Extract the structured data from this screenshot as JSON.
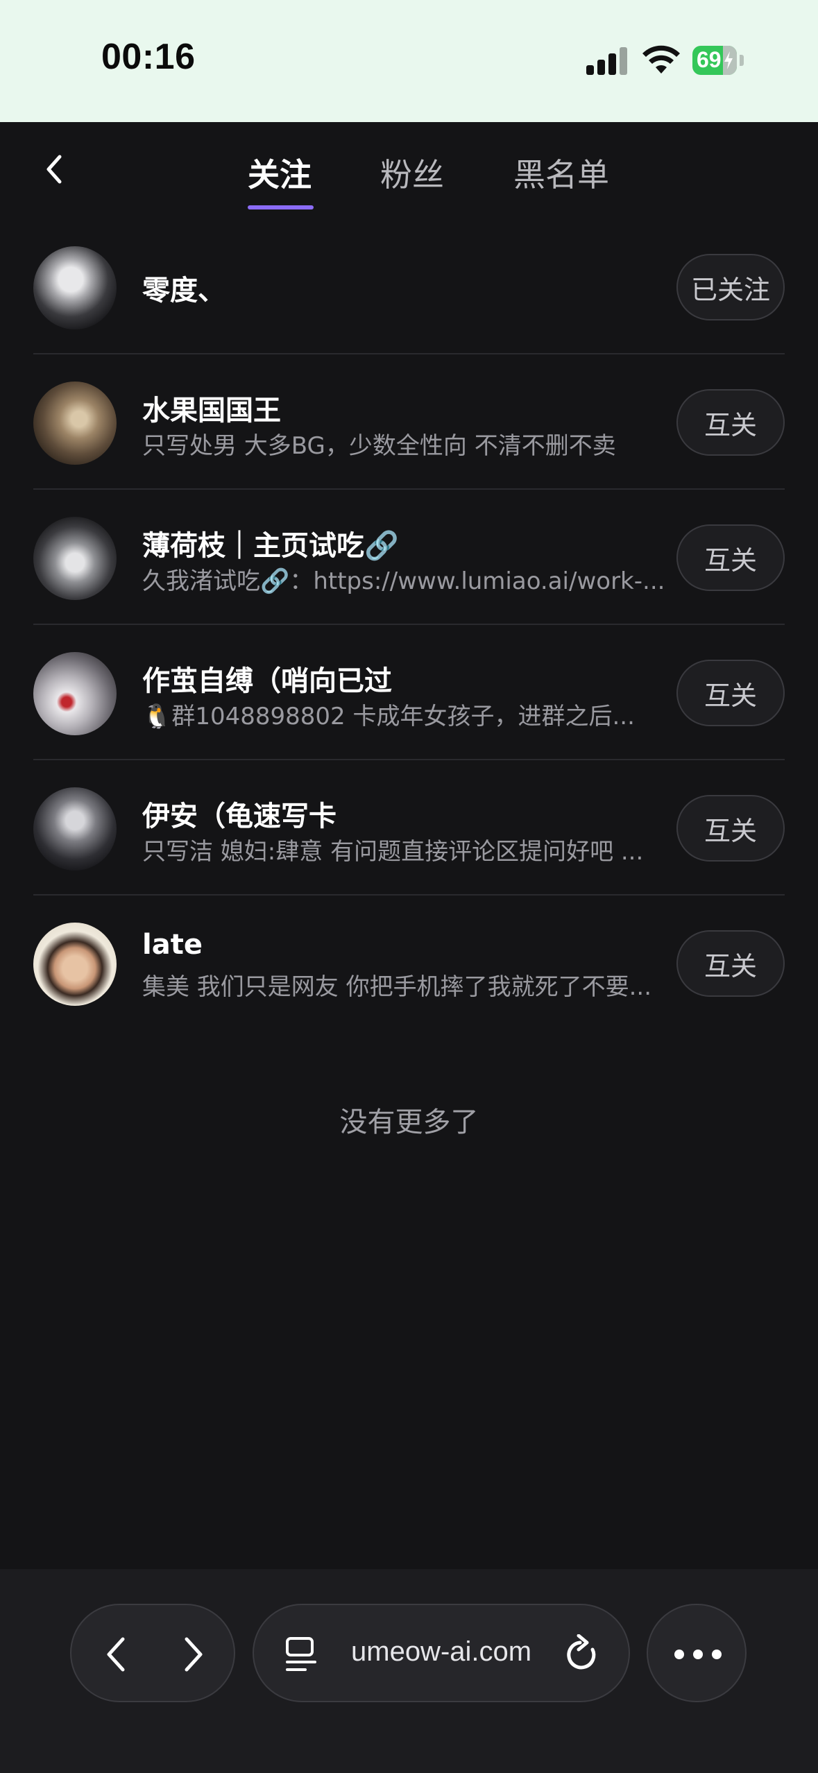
{
  "status_bar": {
    "time": "00:16",
    "battery_percent": "69",
    "battery_level": 0.69,
    "charging": true,
    "signal_bars": 3,
    "colors": {
      "background": "#e9f8ee",
      "battery": "#34c759"
    }
  },
  "header": {
    "back_icon": "chevron-left-icon",
    "tabs": [
      {
        "label": "关注",
        "active": true
      },
      {
        "label": "粉丝",
        "active": false
      },
      {
        "label": "黑名单",
        "active": false
      }
    ],
    "accent_color": "#8b6cf6"
  },
  "follow_list": [
    {
      "name": "零度、",
      "bio": "",
      "button": "已关注"
    },
    {
      "name": "水果国国王",
      "bio": "只写处男 大多BG，少数全性向 不清不删不卖",
      "button": "互关"
    },
    {
      "name": "薄荷枝｜主页试吃🔗",
      "bio": "久我渚试吃🔗：https://www.lumiao.ai/work-...",
      "button": "互关"
    },
    {
      "name": "作茧自缚（哨向已过",
      "bio": "🐧群1048898802 卡成年女孩子，进群之后...",
      "button": "互关"
    },
    {
      "name": "伊安（龟速写卡",
      "bio": "只写洁 媳妇:肆意 有问题直接评论区提问好吧 ...",
      "button": "互关"
    },
    {
      "name": "late",
      "bio": "集美 我们只是网友 你把手机摔了我就死了不要...",
      "button": "互关"
    }
  ],
  "footer_text": "没有更多了",
  "browser_bar": {
    "back_icon": "chevron-left-icon",
    "forward_icon": "chevron-right-icon",
    "tabs_icon": "tabs-icon",
    "url": "umeow-ai.com",
    "reload_icon": "reload-icon",
    "more_icon": "more-icon"
  }
}
